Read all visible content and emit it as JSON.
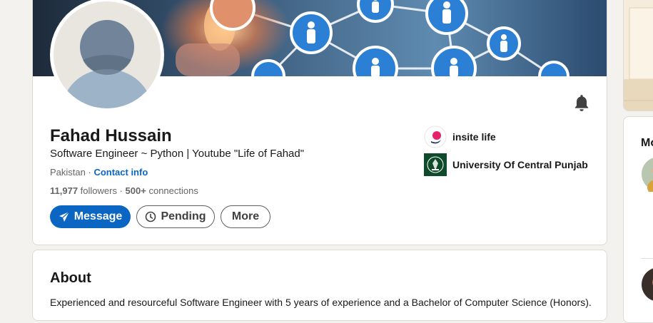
{
  "profile": {
    "name": "Fahad Hussain",
    "headline": "Software Engineer ~ Python | Youtube \"Life of Fahad\"",
    "location": "Pakistan",
    "separator": " · ",
    "contact_info_label": "Contact info",
    "followers_count": "11,977",
    "followers_label": "followers",
    "connections_prefix": " · ",
    "connections_count": "500+",
    "connections_label": "connections"
  },
  "actions": {
    "message_label": "Message",
    "pending_label": "Pending",
    "more_label": "More"
  },
  "organizations": [
    {
      "name": "insite life",
      "icon": "insite-life-logo"
    },
    {
      "name": "University Of Central Punjab",
      "icon": "ucp-logo"
    }
  ],
  "about": {
    "title": "About",
    "text": "Experienced and resourceful Software Engineer with 5 years of experience and a Bachelor of Computer Science (Honors)."
  },
  "sidebar": {
    "title_partial": "Mo"
  },
  "colors": {
    "primary": "#0a66c2",
    "page_bg": "#f4f2ee",
    "banner_dark": "#1a3a5c"
  }
}
